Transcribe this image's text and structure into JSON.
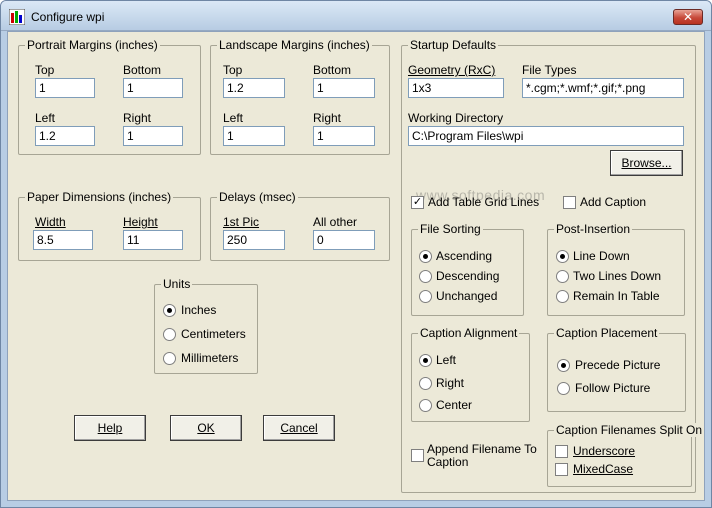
{
  "window": {
    "title": "Configure wpi",
    "close_glyph": "✕"
  },
  "portrait": {
    "title": "Portrait Margins (inches)",
    "top_label": "Top",
    "top_value": "1",
    "bottom_label": "Bottom",
    "bottom_value": "1",
    "left_label": "Left",
    "left_value": "1.2",
    "right_label": "Right",
    "right_value": "1"
  },
  "landscape": {
    "title": "Landscape Margins (inches)",
    "top_label": "Top",
    "top_value": "1.2",
    "bottom_label": "Bottom",
    "bottom_value": "1",
    "left_label": "Left",
    "left_value": "1",
    "right_label": "Right",
    "right_value": "1"
  },
  "paper": {
    "title": "Paper Dimensions (inches)",
    "width_label": "Width",
    "width_value": "8.5",
    "height_label": "Height",
    "height_value": "11"
  },
  "delays": {
    "title": "Delays (msec)",
    "first_label": "1st Pic",
    "first_value": "250",
    "other_label": "All other",
    "other_value": "0"
  },
  "units": {
    "title": "Units",
    "options": [
      "Inches",
      "Centimeters",
      "Millimeters"
    ],
    "selected": "Inches"
  },
  "buttons": {
    "help": "Help",
    "ok": "OK",
    "cancel": "Cancel",
    "browse": "Browse..."
  },
  "startup": {
    "title": "Startup Defaults",
    "geometry_label": "Geometry (RxC)",
    "geometry_value": "1x3",
    "filetypes_label": "File Types",
    "filetypes_value": "*.cgm;*.wmf;*.gif;*.png",
    "workdir_label": "Working Directory",
    "workdir_value": "C:\\Program Files\\wpi",
    "add_grid_label": "Add Table Grid Lines",
    "add_grid_checked": true,
    "add_caption_label": "Add Caption",
    "add_caption_checked": false,
    "file_sorting": {
      "title": "File Sorting",
      "options": [
        "Ascending",
        "Descending",
        "Unchanged"
      ],
      "selected": "Ascending"
    },
    "post_insertion": {
      "title": "Post-Insertion",
      "options": [
        "Line Down",
        "Two Lines Down",
        "Remain In Table"
      ],
      "selected": "Line Down"
    },
    "caption_alignment": {
      "title": "Caption Alignment",
      "options": [
        "Left",
        "Right",
        "Center"
      ],
      "selected": "Left"
    },
    "caption_placement": {
      "title": "Caption Placement",
      "options": [
        "Precede Picture",
        "Follow Picture"
      ],
      "selected": "Precede Picture"
    },
    "append_filename_line1": "Append Filename To",
    "append_filename_line2": "Caption",
    "append_filename_checked": false,
    "split_on": {
      "title": "Caption Filenames Split On",
      "underscore_label": "Underscore",
      "underscore_checked": false,
      "mixedcase_label": "MixedCase",
      "mixedcase_checked": false
    }
  },
  "watermark": "www.softpedia.com"
}
